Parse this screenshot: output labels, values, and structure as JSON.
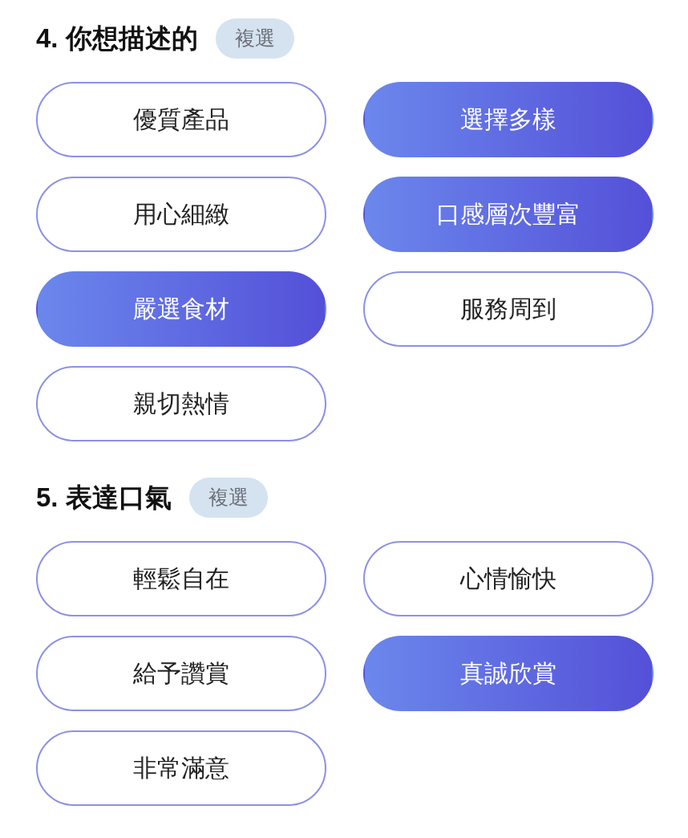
{
  "sections": [
    {
      "number": "4.",
      "title": "你想描述的",
      "badge": "複選",
      "options": [
        {
          "label": "優質產品",
          "selected": false
        },
        {
          "label": "選擇多樣",
          "selected": true
        },
        {
          "label": "用心細緻",
          "selected": false
        },
        {
          "label": "口感層次豐富",
          "selected": true
        },
        {
          "label": "嚴選食材",
          "selected": true
        },
        {
          "label": "服務周到",
          "selected": false
        },
        {
          "label": "親切熱情",
          "selected": false
        }
      ]
    },
    {
      "number": "5.",
      "title": "表達口氣",
      "badge": "複選",
      "options": [
        {
          "label": "輕鬆自在",
          "selected": false
        },
        {
          "label": "心情愉快",
          "selected": false
        },
        {
          "label": "給予讚賞",
          "selected": false
        },
        {
          "label": "真誠欣賞",
          "selected": true
        },
        {
          "label": "非常滿意",
          "selected": false
        }
      ]
    }
  ]
}
